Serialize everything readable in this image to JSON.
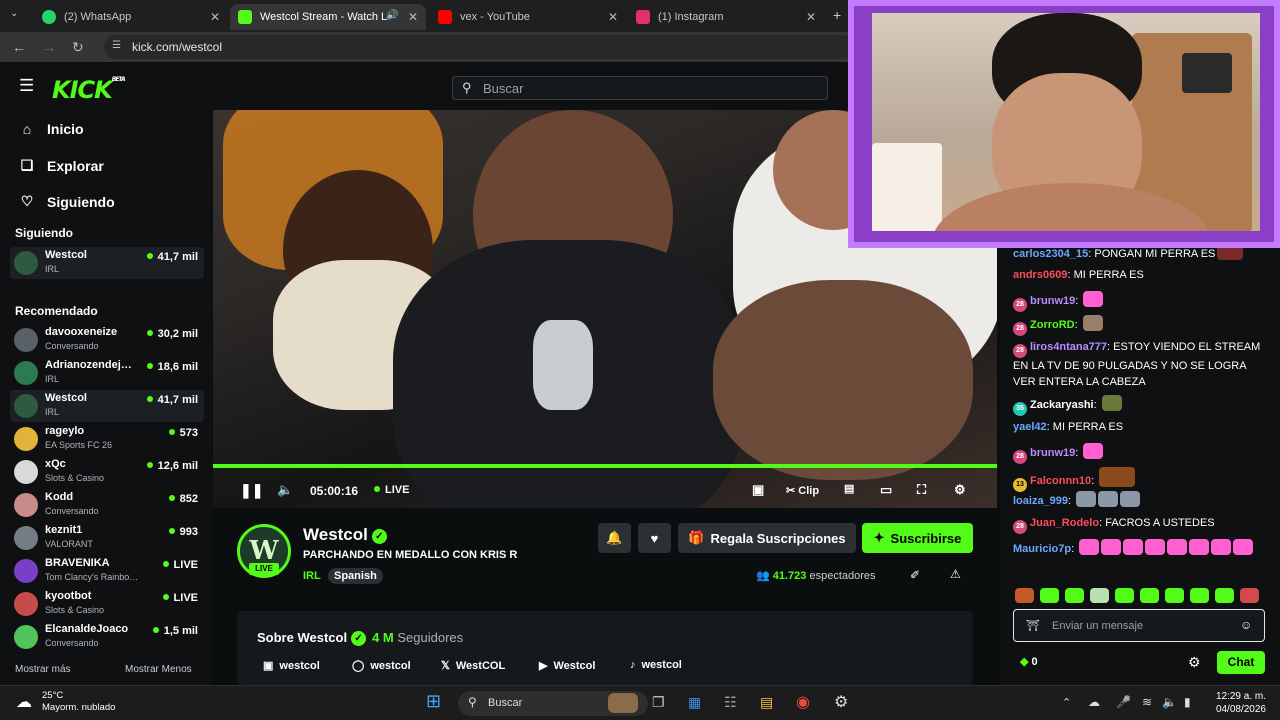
{
  "browser": {
    "tabs": [
      {
        "label": "(2) WhatsApp",
        "icon": "whatsapp-icon",
        "color": "#25d366"
      },
      {
        "label": "Westcol Stream - Watch Li…",
        "icon": "kick-icon",
        "color": "#53fc18"
      },
      {
        "label": "vex - YouTube",
        "icon": "youtube-icon",
        "color": "#ff0000"
      },
      {
        "label": "(1) Instagram",
        "icon": "instagram-icon",
        "color": "#e1306c"
      }
    ],
    "url": "kick.com/westcol"
  },
  "header": {
    "logo": "KICK",
    "logo_beta": "BETA",
    "search_placeholder": "Buscar"
  },
  "sidebar": {
    "nav": [
      {
        "label": "Inicio",
        "icon": "home-icon"
      },
      {
        "label": "Explorar",
        "icon": "compass-icon"
      },
      {
        "label": "Siguiendo",
        "icon": "heart-icon"
      }
    ],
    "following_title": "Siguiendo",
    "following": [
      {
        "name": "Westcol",
        "category": "IRL",
        "viewers": "41,7 mil"
      }
    ],
    "recommended_title": "Recomendado",
    "recommended": [
      {
        "name": "davooxeneize",
        "category": "Conversando",
        "viewers": "30,2 mil"
      },
      {
        "name": "Adrianozendej…",
        "category": "IRL",
        "viewers": "18,6 mil"
      },
      {
        "name": "Westcol",
        "category": "IRL",
        "viewers": "41,7 mil"
      },
      {
        "name": "rageylo",
        "category": "EA Sports FC 26",
        "viewers": "573"
      },
      {
        "name": "xQc",
        "category": "Slots & Casino",
        "viewers": "12,6 mil"
      },
      {
        "name": "Kodd",
        "category": "Conversando",
        "viewers": "852"
      },
      {
        "name": "keznit1",
        "category": "VALORANT",
        "viewers": "993"
      },
      {
        "name": "BRAVENIKA",
        "category": "Tom Clancy's Rainbo…",
        "viewers": "LIVE"
      },
      {
        "name": "kyootbot",
        "category": "Slots & Casino",
        "viewers": "LIVE"
      },
      {
        "name": "ElcanaldeJoaco",
        "category": "Conversando",
        "viewers": "1,5 mil"
      }
    ],
    "show_more": "Mostrar más",
    "show_less": "Mostrar Menos"
  },
  "player": {
    "time": "05:00:16",
    "live": "LIVE",
    "clip": "Clip",
    "progress": 1.0
  },
  "channel": {
    "avatar_letter": "W",
    "live_badge": "LIVE",
    "name": "Westcol",
    "title": "PARCHANDO EN MEDALLO CON KRIS R",
    "category": "IRL",
    "language": "Spanish",
    "gift_label": "Regala Suscripciones",
    "subscribe_label": "Suscribirse",
    "viewers": "41.723",
    "viewers_label": "espectadores"
  },
  "about": {
    "title": "Sobre Westcol",
    "followers": "4 M",
    "followers_label": "Seguidores",
    "socials": [
      {
        "label": "westcol",
        "icon": "kick-icon"
      },
      {
        "label": "westcol",
        "icon": "instagram-icon"
      },
      {
        "label": "WestCOL",
        "icon": "x-icon"
      },
      {
        "label": "Westcol",
        "icon": "youtube-icon"
      },
      {
        "label": "westcol",
        "icon": "tiktok-icon"
      }
    ]
  },
  "chat": {
    "messages": [
      {
        "user": "carlos2304_15",
        "color": "#6ba8ff",
        "text": "PONGAN MI PERRA ES"
      },
      {
        "user": "andrs0609",
        "color": "#ff4b5c",
        "text": "MI PERRA ES"
      },
      {
        "user": "brunw19",
        "color": "#b98dff",
        "text": ""
      },
      {
        "user": "ZorroRD",
        "color": "#53fc18",
        "text": ""
      },
      {
        "user": "liros4ntana777",
        "color": "#b98dff",
        "text": "ESTOY VIENDO EL STREAM EN LA TV DE 90 PULGADAS Y NO SE LOGRA VER ENTERA LA CABEZA"
      },
      {
        "user": "Zackaryashi",
        "color": "#ffffff",
        "text": ""
      },
      {
        "user": "yael42",
        "color": "#6ba8ff",
        "text": "MI PERRA ES"
      },
      {
        "user": "brunw19",
        "color": "#b98dff",
        "text": ""
      },
      {
        "user": "Falconnn10",
        "color": "#ff4b5c",
        "text": ""
      },
      {
        "user": "loaiza_999",
        "color": "#6ba8ff",
        "text": ""
      },
      {
        "user": "Juan_Rodelo",
        "color": "#ff4b5c",
        "text": "FACROS A USTEDES"
      },
      {
        "user": "Mauricio7p",
        "color": "#6ba8ff",
        "text": ""
      }
    ],
    "input_placeholder": "Enviar un mensaje",
    "points": "0",
    "send_label": "Chat"
  },
  "taskbar": {
    "temp": "25°C",
    "weather": "Mayorm. nublado",
    "search": "Buscar",
    "time": "12:29 a. m.",
    "date": "04/08/2026"
  }
}
